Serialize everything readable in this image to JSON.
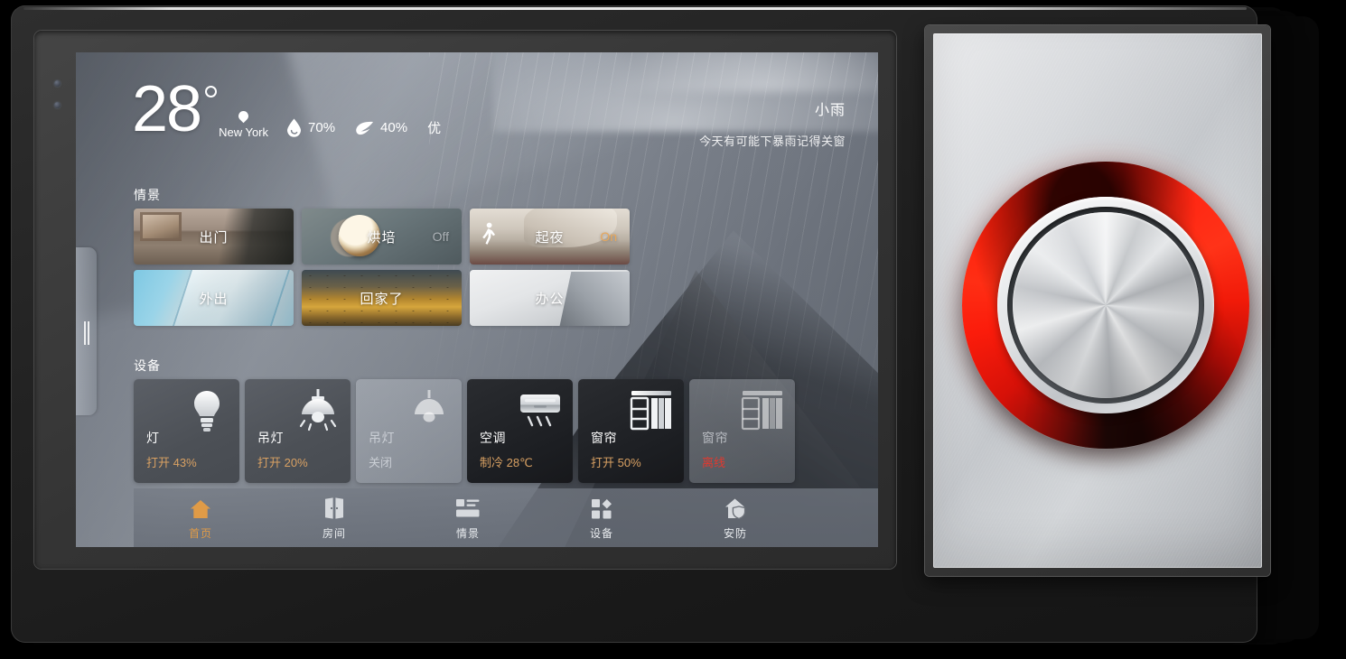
{
  "weather": {
    "temperature": "28",
    "city": "New York",
    "humidity": "70%",
    "pm": "40%",
    "air_quality": "优",
    "condition": "小雨",
    "tip": "今天有可能下暴雨记得关窗",
    "humidity_icon": "water-drop-icon",
    "pm_icon": "leaf-icon",
    "location_icon": "map-pin-icon"
  },
  "sections": {
    "scenes_title": "情景",
    "devices_title": "设备"
  },
  "scenes": [
    {
      "name": "出门",
      "state": "",
      "state_kind": "none",
      "art": "art-chumen",
      "badge": ""
    },
    {
      "name": "烘培",
      "state": "Off",
      "state_kind": "off",
      "art": "art-hongpei",
      "badge": ""
    },
    {
      "name": "起夜",
      "state": "On",
      "state_kind": "on",
      "art": "art-qiye",
      "badge": "walking-person-icon"
    },
    {
      "name": "外出",
      "state": "",
      "state_kind": "none",
      "art": "art-waichu",
      "badge": ""
    },
    {
      "name": "回家了",
      "state": "",
      "state_kind": "none",
      "art": "art-huijia",
      "badge": ""
    },
    {
      "name": "办公",
      "state": "",
      "state_kind": "none",
      "art": "art-bangong",
      "badge": ""
    }
  ],
  "devices": [
    {
      "name": "灯",
      "status": "打开 43%",
      "status_kind": "on",
      "style": "dark",
      "icon": "light-bulb-icon"
    },
    {
      "name": "吊灯",
      "status": "打开 20%",
      "status_kind": "on",
      "style": "dark",
      "icon": "pendant-lamp-icon"
    },
    {
      "name": "吊灯",
      "status": "关闭",
      "status_kind": "off",
      "style": "ghost",
      "icon": "pendant-lamp-off-icon"
    },
    {
      "name": "空调",
      "status": "制冷 28℃",
      "status_kind": "on",
      "style": "darker",
      "icon": "air-conditioner-icon"
    },
    {
      "name": "窗帘",
      "status": "打开 50%",
      "status_kind": "on",
      "style": "darker",
      "icon": "curtain-icon"
    },
    {
      "name": "窗帘",
      "status": "离线",
      "status_kind": "alert",
      "style": "ghost",
      "icon": "curtain-offline-icon"
    }
  ],
  "nav": [
    {
      "label": "首页",
      "icon": "home-icon",
      "active": true
    },
    {
      "label": "房间",
      "icon": "room-icon",
      "active": false
    },
    {
      "label": "情景",
      "icon": "scene-icon",
      "active": false
    },
    {
      "label": "设备",
      "icon": "devices-icon",
      "active": false
    },
    {
      "label": "安防",
      "icon": "security-icon",
      "active": false
    }
  ],
  "knob": {
    "name": "rotary-dimmer-knob",
    "ring_color": "#ff2010",
    "face_color": "#d6d9dc"
  },
  "colors": {
    "accent_on": "#e09b47",
    "status_on": "#d9a163",
    "status_alert": "#e0392f",
    "text_primary": "#ffffff",
    "text_dim": "rgba(238,241,245,.62)"
  }
}
